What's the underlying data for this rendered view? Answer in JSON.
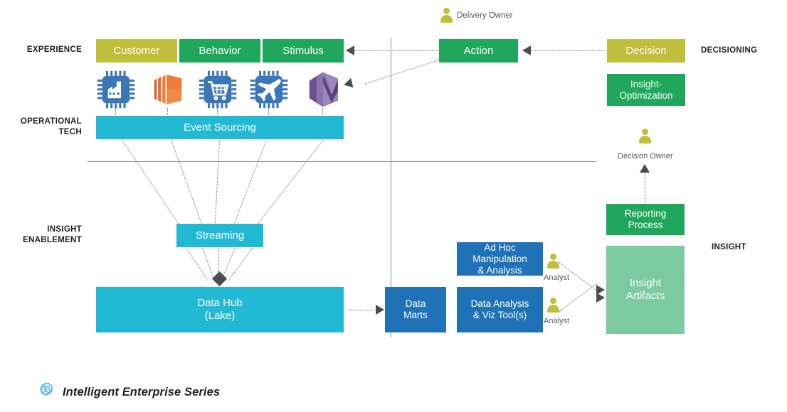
{
  "diagram": {
    "title": "Intelligent Enterprise Series",
    "brand_icon": "gear-person-icon",
    "band_labels": {
      "experience": "EXPERIENCE",
      "operational_tech": "OPERATIONAL\nTECH",
      "insight_enablement": "INSIGHT\nENABLEMENT",
      "decisioning": "DECISIONING",
      "insight": "INSIGHT"
    },
    "colors": {
      "olive": "#bfbf3b",
      "green": "#1fa85c",
      "light_green": "#7dc9a0",
      "cyan": "#22b9d4",
      "blue": "#1f72b8",
      "line": "#8c8c8c",
      "arrow": "#4d4d4d",
      "icon_blue": "#3b76b8",
      "icon_orange": "#ee7d3b",
      "icon_purple": "#7a5ea3",
      "brand_cyan": "#4db8dd"
    },
    "nodes": [
      {
        "id": "customer",
        "label": "Customer",
        "color": "olive"
      },
      {
        "id": "behavior",
        "label": "Behavior",
        "color": "green"
      },
      {
        "id": "stimulus",
        "label": "Stimulus",
        "color": "green"
      },
      {
        "id": "action",
        "label": "Action",
        "color": "green"
      },
      {
        "id": "decision",
        "label": "Decision",
        "color": "olive"
      },
      {
        "id": "insight_opt",
        "label": "Insight-\nOptimization",
        "color": "green"
      },
      {
        "id": "event_sourcing",
        "label": "Event Sourcing",
        "color": "cyan"
      },
      {
        "id": "streaming",
        "label": "Streaming",
        "color": "cyan"
      },
      {
        "id": "data_hub",
        "label": "Data Hub\n(Lake)",
        "color": "cyan"
      },
      {
        "id": "data_marts",
        "label": "Data\nMarts",
        "color": "blue"
      },
      {
        "id": "ad_hoc",
        "label": "Ad Hoc\nManipulation\n& Analysis",
        "color": "blue"
      },
      {
        "id": "data_analysis",
        "label": "Data Analysis\n& Viz Tool(s)",
        "color": "blue"
      },
      {
        "id": "reporting",
        "label": "Reporting\nProcess",
        "color": "green"
      },
      {
        "id": "insight_art",
        "label": "Insight\nArtifacts",
        "color": "light_green"
      }
    ],
    "actors": [
      {
        "id": "delivery_owner",
        "label": "Delivery Owner"
      },
      {
        "id": "decision_owner",
        "label": "Decision Owner"
      },
      {
        "id": "analyst_top",
        "label": "Analyst"
      },
      {
        "id": "analyst_bottom",
        "label": "Analyst"
      }
    ],
    "tech_icons": [
      {
        "id": "factory-chip-icon",
        "name": "factory-chip-icon"
      },
      {
        "id": "layered-stack-icon",
        "name": "layered-stack-icon"
      },
      {
        "id": "cart-chip-icon",
        "name": "cart-chip-icon"
      },
      {
        "id": "airplane-chip-icon",
        "name": "airplane-chip-icon"
      },
      {
        "id": "hexagon-check-icon",
        "name": "hexagon-check-icon"
      }
    ]
  }
}
